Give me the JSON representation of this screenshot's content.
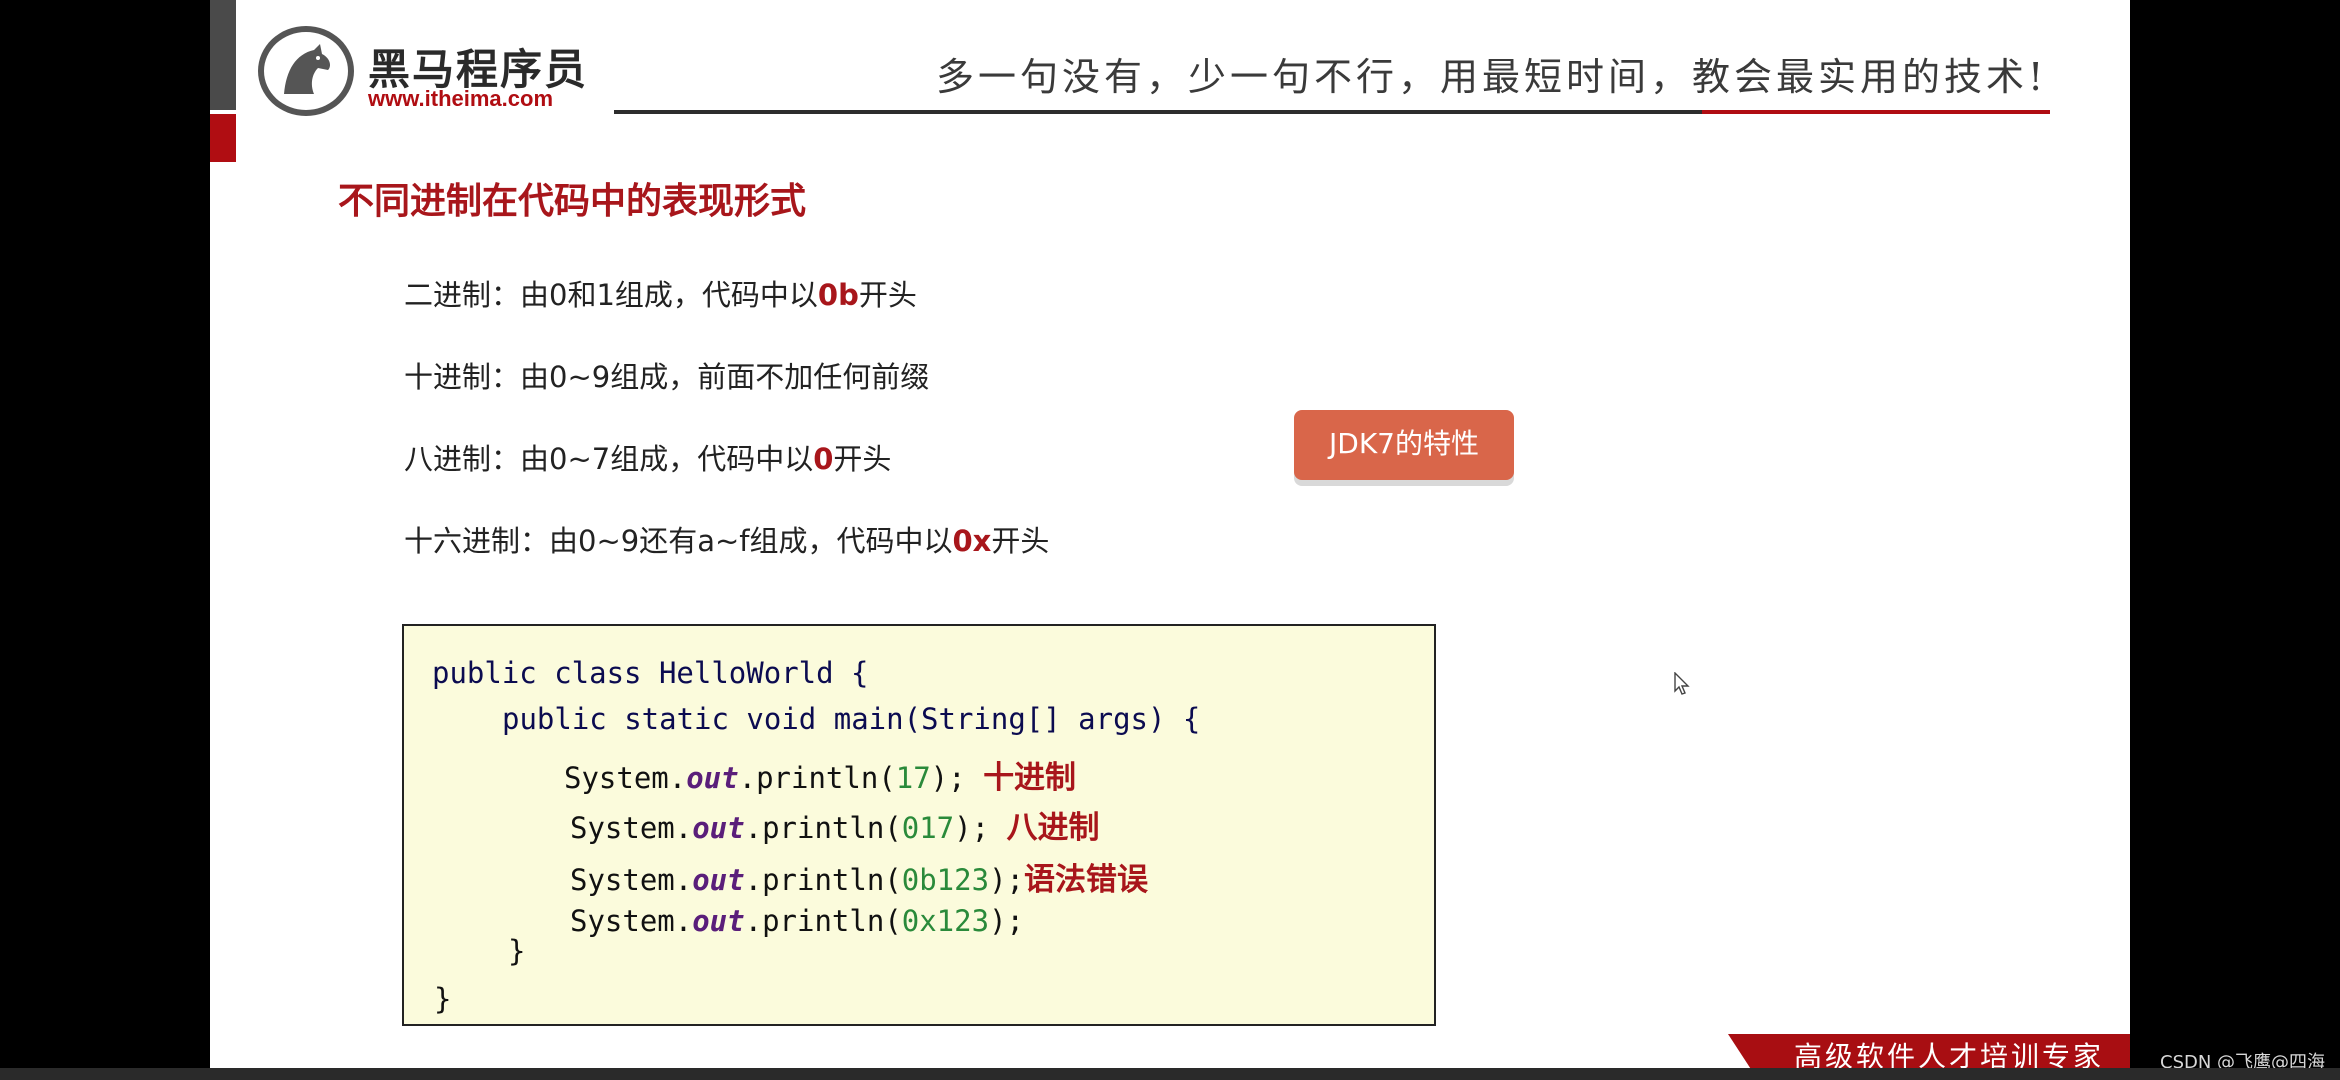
{
  "header": {
    "logo_name": "黑马程序员",
    "logo_url": "www.itheima.com",
    "slogan": "多一句没有，少一句不行，用最短时间，教会最实用的技术!"
  },
  "section_title": "不同进制在代码中的表现形式",
  "items": [
    {
      "label": "二进制：由0和1组成，代码中以",
      "prefix": "0b",
      "suffix": "开头"
    },
    {
      "label": "十进制：由0~9组成，前面不加任何前缀",
      "prefix": "",
      "suffix": ""
    },
    {
      "label": "八进制：由0~7组成，代码中以",
      "prefix": "0",
      "suffix": "开头"
    },
    {
      "label": "十六进制：由0~9还有a~f组成，代码中以",
      "prefix": "0x",
      "suffix": "开头"
    }
  ],
  "badge": "JDK7的特性",
  "code": {
    "line1": "public class HelloWorld {",
    "line2": "public static void main(String[] args) {",
    "sys": "System.",
    "out": "out",
    "println": ".println(",
    "close": ");",
    "values": [
      "17",
      "017",
      "0b123",
      "0x123"
    ],
    "comments": [
      "十进制",
      "八进制",
      "语法错误",
      ""
    ],
    "brace_inner": "}",
    "brace_outer": "}"
  },
  "footer": {
    "tagline": "高级软件人才培训专家",
    "credit": "CSDN @飞鹰@四海"
  },
  "colors": {
    "accent_red": "#a8161b",
    "badge_bg": "#d9664a",
    "code_bg": "#fbfbdc"
  }
}
